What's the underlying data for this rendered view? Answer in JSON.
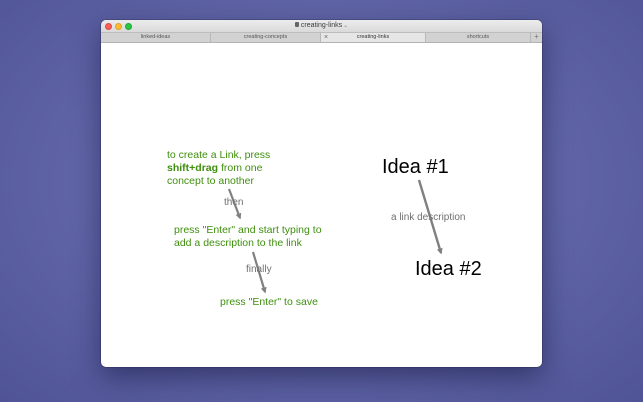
{
  "window": {
    "title": "creating-links"
  },
  "tabs": [
    {
      "label": "linked-ideas",
      "active": false
    },
    {
      "label": "creating-concepts",
      "active": false
    },
    {
      "label": "creating-links",
      "active": true
    },
    {
      "label": "shortcuts",
      "active": false
    }
  ],
  "tab_close_glyph": "×",
  "tab_add_glyph": "+",
  "canvas": {
    "instruction1": {
      "line1": "to create a Link, press",
      "line2_bold": "shift+drag",
      "line2_rest": " from one",
      "line3": "concept to another"
    },
    "then_label": "then",
    "instruction2": {
      "line1": "press \"Enter\" and start typing to",
      "line2": "add a description to the link"
    },
    "finally_label": "finally",
    "instruction3": "press \"Enter\" to save",
    "idea1": "Idea #1",
    "link_description": "a link description",
    "idea2": "Idea #2"
  },
  "colors": {
    "instruction_text": "#3f8f0e",
    "link_label": "#707070",
    "arrow": "#808080"
  }
}
